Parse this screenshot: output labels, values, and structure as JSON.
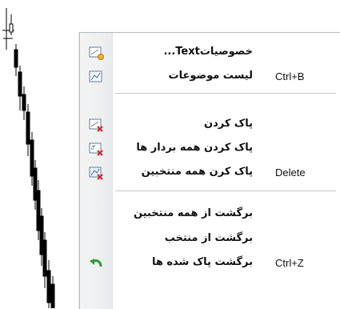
{
  "menu": {
    "items": [
      {
        "label": "خصوصیاتText...",
        "shortcut": "",
        "icon": "properties-icon"
      },
      {
        "label": "لیست موضوعات",
        "shortcut": "Ctrl+B",
        "icon": "objects-list-icon"
      },
      {
        "label": "پاک کردن",
        "shortcut": "",
        "icon": "delete-icon"
      },
      {
        "label": "پاک کردن همه بردار ها",
        "shortcut": "",
        "icon": "delete-all-arrows-icon"
      },
      {
        "label": "پاک کرن همه منتخبین",
        "shortcut": "Delete",
        "icon": "delete-selected-icon"
      },
      {
        "label": "برگشت از همه منتخبین",
        "shortcut": "",
        "icon": ""
      },
      {
        "label": "برگشت از منتخب",
        "shortcut": "",
        "icon": ""
      },
      {
        "label": "برگشت پاک شده ها",
        "shortcut": "Ctrl+Z",
        "icon": "undo-icon"
      }
    ]
  }
}
